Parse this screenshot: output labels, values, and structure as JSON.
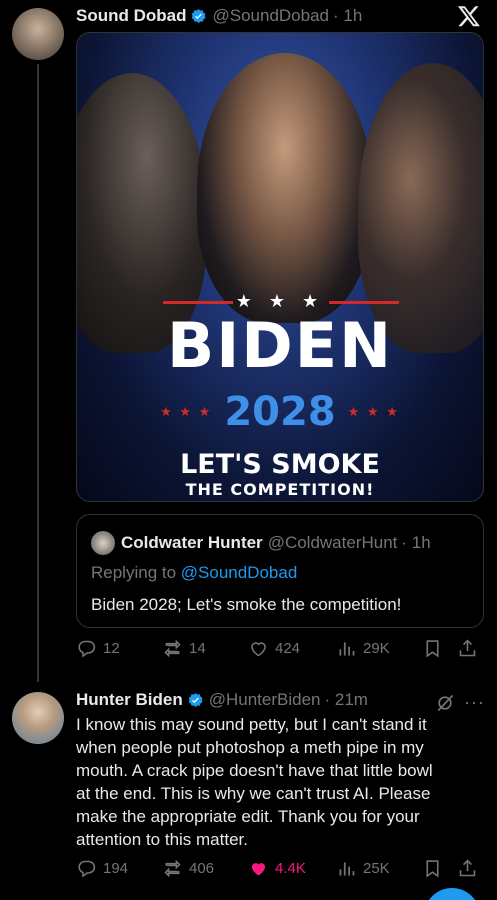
{
  "tweet1": {
    "name": "Sound Dobad",
    "handle": "@SoundDobad",
    "time": "· 1h",
    "poster": {
      "stars": "★ ★ ★",
      "headline": "BIDEN",
      "year": "2028",
      "side_stars": "★ ★ ★",
      "slogan_line1": "LET'S SMOKE",
      "slogan_line2": "THE COMPETITION!"
    },
    "quote": {
      "name": "Coldwater Hunter",
      "handle": "@ColdwaterHunt",
      "time": "· 1h",
      "replying_prefix": "Replying to ",
      "replying_mention": "@SoundDobad",
      "text": "Biden 2028; Let's smoke the competition!"
    },
    "stats": {
      "replies": "12",
      "reposts": "14",
      "likes": "424",
      "views": "29K"
    }
  },
  "tweet2": {
    "name": "Hunter Biden",
    "handle": "@HunterBiden",
    "time": "· 21m",
    "text": "I know this may sound petty, but I can't stand it\nwhen people put photoshop a meth pipe in my\nmouth. A crack pipe doesn't have that little bowl\nat the end. This is why we can't trust AI. Please\nmake the appropriate edit. Thank you for your\nattention to this matter.",
    "more": "···",
    "stats": {
      "replies": "194",
      "reposts": "406",
      "likes": "4.4K",
      "views": "25K"
    }
  },
  "colors": {
    "accent": "#1d9bf0",
    "like": "#f91880",
    "muted": "#71767b",
    "text": "#e7e9ea",
    "background": "#000000"
  },
  "icons": [
    "verified-badge-icon",
    "x-logo-icon",
    "reply-icon",
    "repost-icon",
    "heart-icon",
    "views-icon",
    "bookmark-icon",
    "share-icon",
    "grok-icon",
    "more-icon"
  ]
}
